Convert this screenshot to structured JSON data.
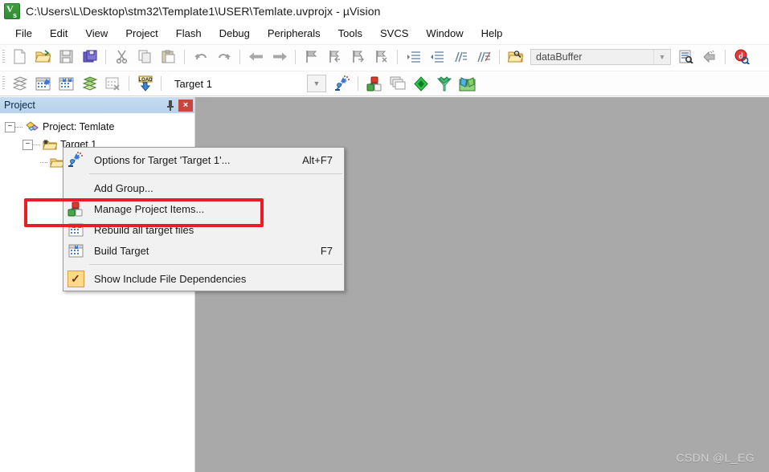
{
  "window": {
    "title": "C:\\Users\\L\\Desktop\\stm32\\Template1\\USER\\Temlate.uvprojx - µVision",
    "app_icon": "uvision-icon"
  },
  "menubar": {
    "items": [
      {
        "label": "File"
      },
      {
        "label": "Edit"
      },
      {
        "label": "View"
      },
      {
        "label": "Project"
      },
      {
        "label": "Flash"
      },
      {
        "label": "Debug"
      },
      {
        "label": "Peripherals"
      },
      {
        "label": "Tools"
      },
      {
        "label": "SVCS"
      },
      {
        "label": "Window"
      },
      {
        "label": "Help"
      }
    ]
  },
  "toolbar_main": {
    "buttons": [
      {
        "icon": "new-file-icon"
      },
      {
        "icon": "open-folder-icon"
      },
      {
        "icon": "save-icon"
      },
      {
        "icon": "save-all-icon"
      },
      {
        "icon": "cut-icon"
      },
      {
        "icon": "copy-icon"
      },
      {
        "icon": "paste-icon"
      },
      {
        "icon": "undo-icon"
      },
      {
        "icon": "redo-icon"
      },
      {
        "icon": "navigate-back-icon"
      },
      {
        "icon": "navigate-forward-icon"
      },
      {
        "icon": "bookmark-toggle-icon"
      },
      {
        "icon": "bookmark-prev-icon"
      },
      {
        "icon": "bookmark-next-icon"
      },
      {
        "icon": "bookmark-clear-icon"
      },
      {
        "icon": "indent-icon"
      },
      {
        "icon": "outdent-icon"
      },
      {
        "icon": "comment-icon"
      },
      {
        "icon": "uncomment-icon"
      },
      {
        "icon": "open-file-browse-icon"
      }
    ],
    "search_combo": {
      "value": "dataBuffer",
      "placeholder": "dataBuffer",
      "arrow": "chevron-down-icon"
    },
    "trailing_buttons": [
      {
        "icon": "find-in-files-icon"
      },
      {
        "icon": "incremental-find-icon"
      },
      {
        "icon": "debug-start-icon"
      }
    ]
  },
  "toolbar_build": {
    "buttons": [
      {
        "icon": "translate-icon"
      },
      {
        "icon": "build-icon"
      },
      {
        "icon": "rebuild-icon"
      },
      {
        "icon": "batch-build-icon"
      },
      {
        "icon": "stop-build-icon"
      },
      {
        "icon": "download-icon"
      }
    ],
    "target_combo": {
      "value": "Target 1",
      "arrow": "chevron-down-icon"
    },
    "right_buttons": [
      {
        "icon": "options-for-target-icon"
      },
      {
        "icon": "manage-project-items-icon"
      },
      {
        "icon": "manage-multi-project-icon"
      },
      {
        "icon": "pack-installer-icon"
      },
      {
        "icon": "manage-run-time-env-icon"
      },
      {
        "icon": "books-icon"
      }
    ]
  },
  "project_panel": {
    "title": "Project",
    "pin_icon": "pin-icon",
    "close_icon": "close-icon",
    "close_label": "×",
    "tree": [
      {
        "level": 1,
        "label": "Project: Temlate",
        "icon": "project-icon",
        "expander": "−"
      },
      {
        "level": 2,
        "label": "Target 1",
        "icon": "target-folder-icon",
        "expander": "−"
      }
    ]
  },
  "context_menu": {
    "items": [
      {
        "label": "Options for Target 'Target 1'...",
        "accel": "Alt+F7",
        "icon": "options-for-target-icon",
        "type": "item"
      },
      {
        "type": "separator"
      },
      {
        "label": "Add Group...",
        "accel": "",
        "icon": "",
        "type": "item"
      },
      {
        "label": "Manage Project Items...",
        "accel": "",
        "icon": "manage-project-items-icon",
        "type": "item",
        "highlighted": true
      },
      {
        "label": "Rebuild all target files",
        "accel": "",
        "icon": "rebuild-icon",
        "type": "item"
      },
      {
        "label": "Build Target",
        "accel": "F7",
        "icon": "build-icon",
        "type": "item"
      },
      {
        "type": "separator"
      },
      {
        "label": "Show Include File Dependencies",
        "accel": "",
        "icon": "checked-box-icon",
        "type": "checkitem",
        "check_glyph": "✓"
      }
    ]
  },
  "workspace": {
    "watermark": "CSDN @L_EG",
    "background_color": "#a9a9a9"
  },
  "colors": {
    "accent_highlight": "#ec1c24",
    "panel_header": "#bdd6ee",
    "menu_background": "#f1f1f1",
    "close_button": "#c9453f"
  }
}
